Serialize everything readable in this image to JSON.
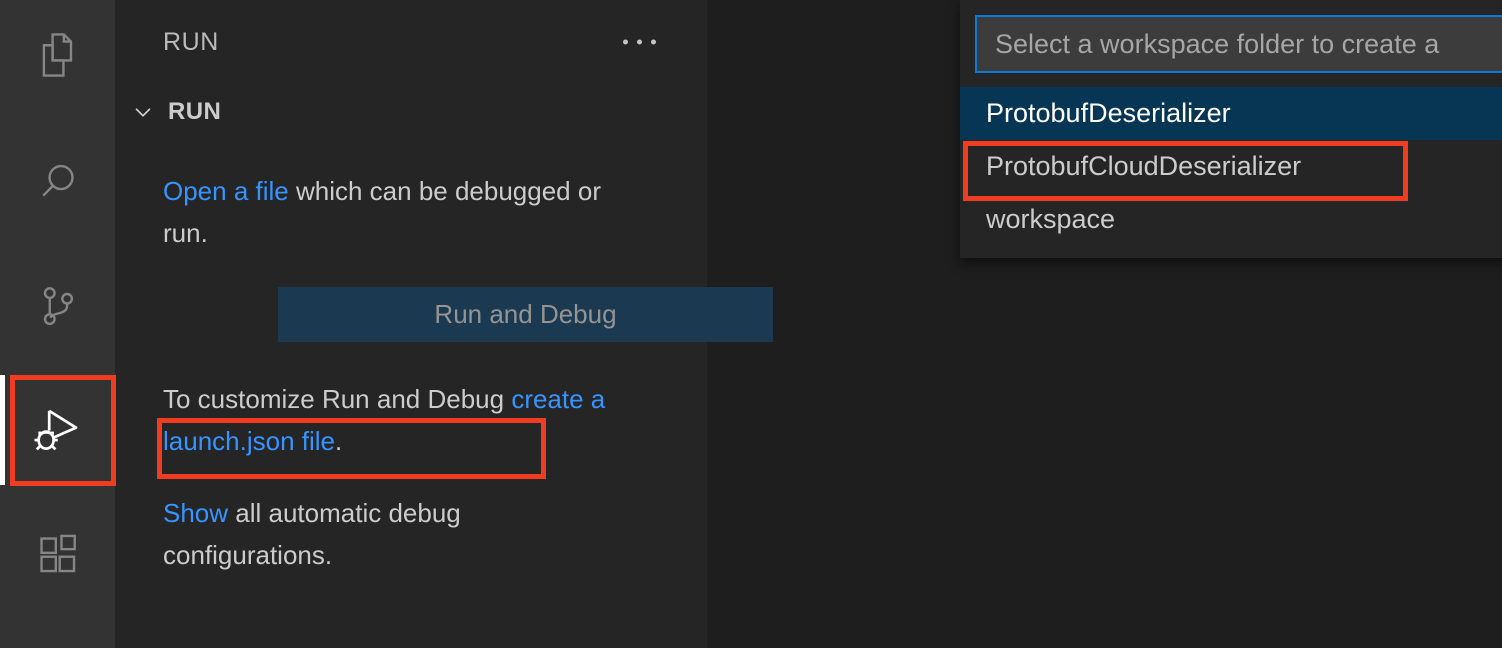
{
  "activity_bar": {
    "items": [
      {
        "name": "explorer",
        "icon": "files-icon",
        "active": false
      },
      {
        "name": "search",
        "icon": "search-icon",
        "active": false
      },
      {
        "name": "source-control",
        "icon": "source-control-icon",
        "active": false
      },
      {
        "name": "run-and-debug",
        "icon": "run-and-debug-icon",
        "active": true
      },
      {
        "name": "extensions",
        "icon": "extensions-icon",
        "active": false
      }
    ]
  },
  "sidebar": {
    "title": "RUN",
    "more_actions_icon": "ellipsis-icon",
    "section": {
      "chevron_icon": "chevron-down-icon",
      "label": "RUN"
    },
    "welcome": {
      "open_link": "Open a file",
      "open_rest": " which can be debugged or run.",
      "run_debug_button": "Run and Debug",
      "customize_prefix": "To customize Run and Debug ",
      "customize_link": "create a launch.json file",
      "customize_suffix": ".",
      "show_link": "Show",
      "show_rest": " all automatic debug configurations."
    }
  },
  "quick_pick": {
    "input_value": "",
    "input_placeholder": "Select a workspace folder to create a",
    "items": [
      {
        "label": "ProtobufDeserializer",
        "selected": true
      },
      {
        "label": "ProtobufCloudDeserializer",
        "selected": false
      },
      {
        "label": "workspace",
        "selected": false
      }
    ]
  },
  "annotations": {
    "color": "#f03c21",
    "boxes": [
      {
        "name": "debug-icon-highlight"
      },
      {
        "name": "launch-json-link-highlight"
      },
      {
        "name": "protobuf-cloud-deserializer-highlight"
      }
    ]
  },
  "colors": {
    "activity_bar_bg": "#333333",
    "sidebar_bg": "#252526",
    "editor_bg": "#1e1e1e",
    "link": "#3794ff",
    "button_bg": "#1b3a52",
    "selected_row_bg": "#073655",
    "focus_border": "#0e7ad4"
  }
}
